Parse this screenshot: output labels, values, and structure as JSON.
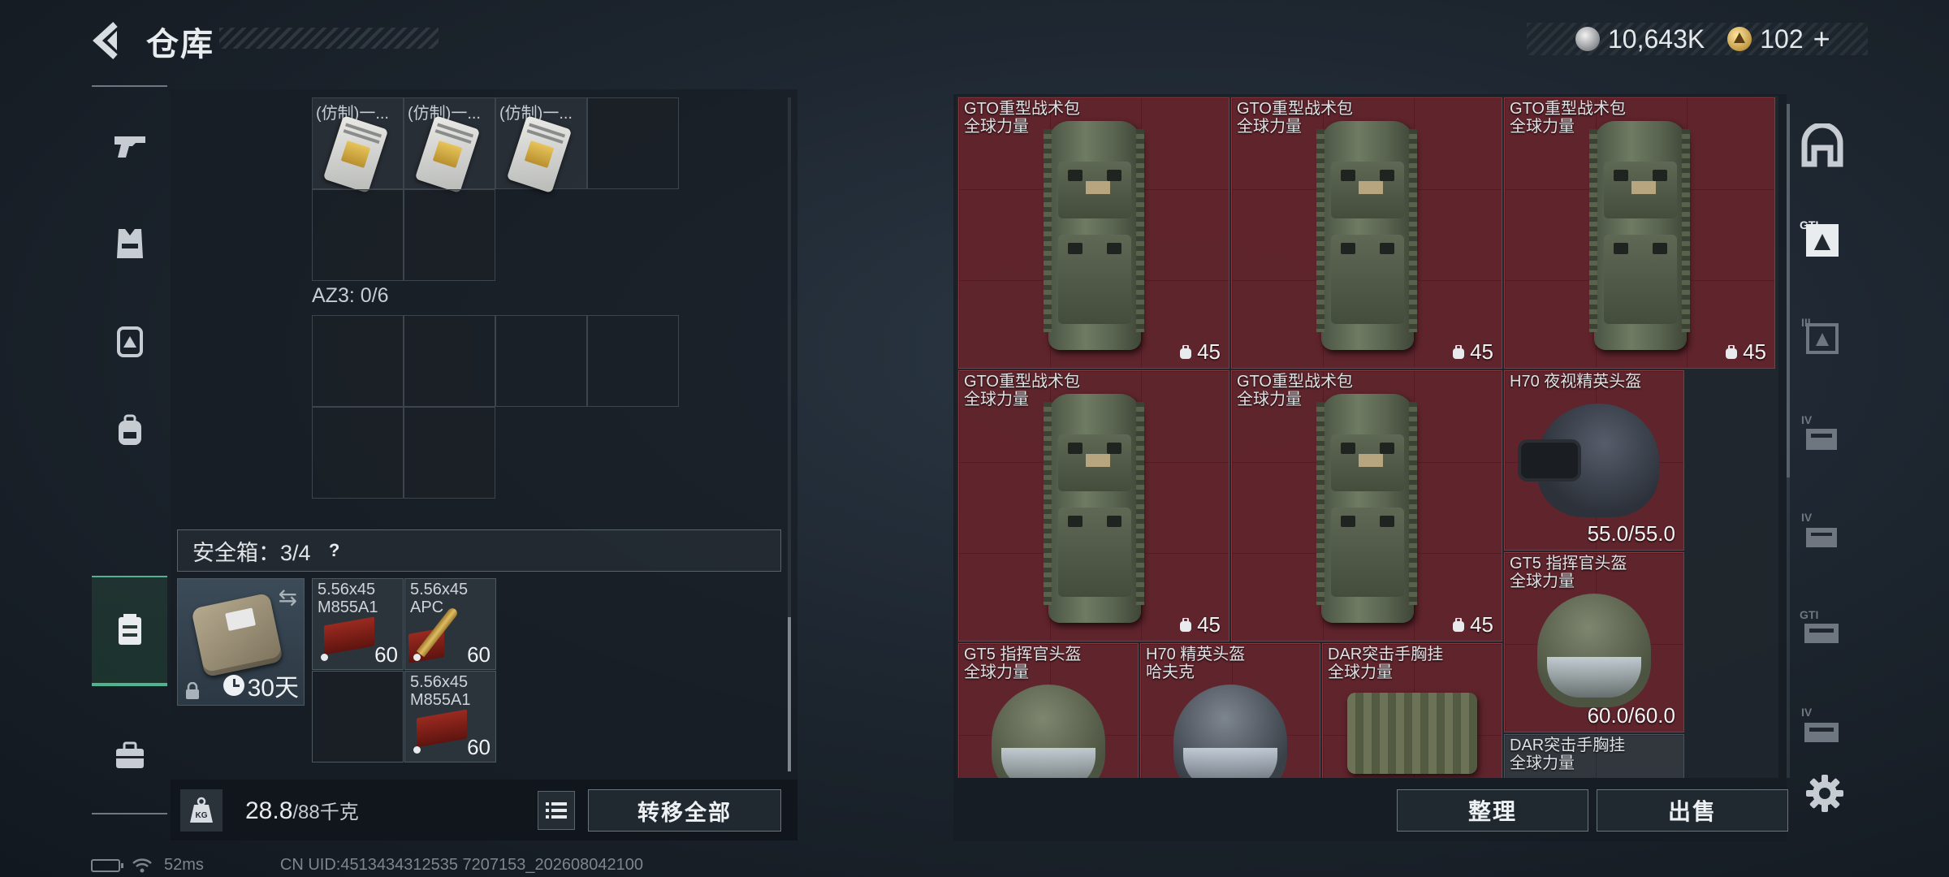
{
  "header": {
    "title": "仓库",
    "currency": {
      "silver": "10,643K",
      "gold": "102",
      "plus": "+"
    }
  },
  "left_rail": {
    "items": [
      {
        "name": "weapons",
        "icon": "pistol-icon"
      },
      {
        "name": "armor",
        "icon": "vest-icon"
      },
      {
        "name": "chest-rig",
        "icon": "rig-icon"
      },
      {
        "name": "backpack",
        "icon": "backpack-icon"
      },
      {
        "name": "container",
        "icon": "container-icon",
        "active": true
      },
      {
        "name": "toolbox",
        "icon": "toolbox-icon"
      }
    ]
  },
  "storage": {
    "top_items": [
      {
        "label": "(仿制)一..."
      },
      {
        "label": "(仿制)一..."
      },
      {
        "label": "(仿制)一..."
      }
    ],
    "az3_label": "AZ3: 0/6",
    "safe_header": "安全箱：3/4",
    "help_glyph": "?",
    "safebox": {
      "days": "30天"
    },
    "ammo": [
      {
        "name": "5.56x45\nM855A1",
        "count": "60"
      },
      {
        "name": "5.56x45\nAPC",
        "count": "60"
      },
      {
        "name": "5.56x45\nM855A1",
        "count": "60"
      }
    ],
    "weight": {
      "current": "28.8",
      "max": "/88千克"
    },
    "transfer_all": "转移全部"
  },
  "inventory": {
    "items": [
      {
        "name": "GTO重型战术包\n全球力量",
        "value": "45",
        "kind": "backpack"
      },
      {
        "name": "GTO重型战术包\n全球力量",
        "value": "45",
        "kind": "backpack"
      },
      {
        "name": "GTO重型战术包\n全球力量",
        "value": "45",
        "kind": "backpack"
      },
      {
        "name": "GTO重型战术包\n全球力量",
        "value": "45",
        "kind": "backpack"
      },
      {
        "name": "GTO重型战术包\n全球力量",
        "value": "45",
        "kind": "backpack"
      },
      {
        "name": "H70 夜视精英头盔",
        "value": "55.0/55.0",
        "kind": "nvg-helmet"
      },
      {
        "name": "GT5 指挥官头盔\n全球力量",
        "value": "60.0/60.0",
        "kind": "helmet"
      },
      {
        "name": "GT5 指挥官头盔\n全球力量",
        "value": "",
        "kind": "helmet"
      },
      {
        "name": "H70 精英头盔\n哈夫克",
        "value": "",
        "kind": "helmet-dark"
      },
      {
        "name": "DAR突击手胸挂\n全球力量",
        "value": "",
        "kind": "vest"
      },
      {
        "name": "DAR突击手胸挂\n全球力量",
        "value": "",
        "kind": "vest"
      }
    ],
    "sort_button": "整理",
    "sell_button": "出售"
  },
  "right_rail": {
    "items": [
      {
        "icon": "safehouse-icon",
        "label": ""
      },
      {
        "icon": "gti-tier-icon",
        "label": "GTI"
      },
      {
        "icon": "tier3-icon",
        "label": "III"
      },
      {
        "icon": "tier4-icon",
        "label": "IV"
      },
      {
        "icon": "tier4-icon",
        "label": "IV"
      },
      {
        "icon": "gti-tier-icon",
        "label": "GTI"
      },
      {
        "icon": "tier4-icon",
        "label": "IV"
      }
    ]
  },
  "status": {
    "ping": "52ms",
    "uid": "CN UID:4513434312535 7207153_202608042100"
  },
  "colors": {
    "accent": "#4fb38f",
    "item_red": "#6e242c",
    "panel": "#171d24"
  }
}
